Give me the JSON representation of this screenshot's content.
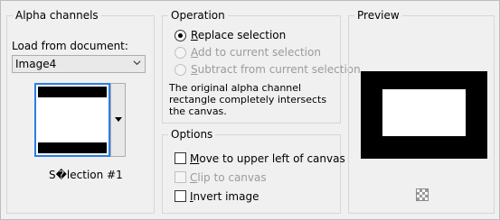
{
  "alpha": {
    "title": "Alpha channels",
    "load_label": "Load from document:",
    "document_value": "Image4",
    "selection_label": "S�lection #1"
  },
  "operation": {
    "title": "Operation",
    "options": [
      {
        "label": "Replace selection",
        "selected": true,
        "enabled": true
      },
      {
        "label": "Add to current selection",
        "selected": false,
        "enabled": false
      },
      {
        "label": "Subtract from current selection",
        "selected": false,
        "enabled": false
      }
    ],
    "description": "The original alpha channel rectangle completely intersects the canvas."
  },
  "options": {
    "title": "Options",
    "checkboxes": [
      {
        "label": "Move to upper left of canvas",
        "checked": false,
        "enabled": true
      },
      {
        "label": "Clip to canvas",
        "checked": false,
        "enabled": false
      },
      {
        "label": "Invert image",
        "checked": false,
        "enabled": true
      }
    ]
  },
  "preview": {
    "title": "Preview",
    "zoom_icon": "checkerboard-icon"
  }
}
